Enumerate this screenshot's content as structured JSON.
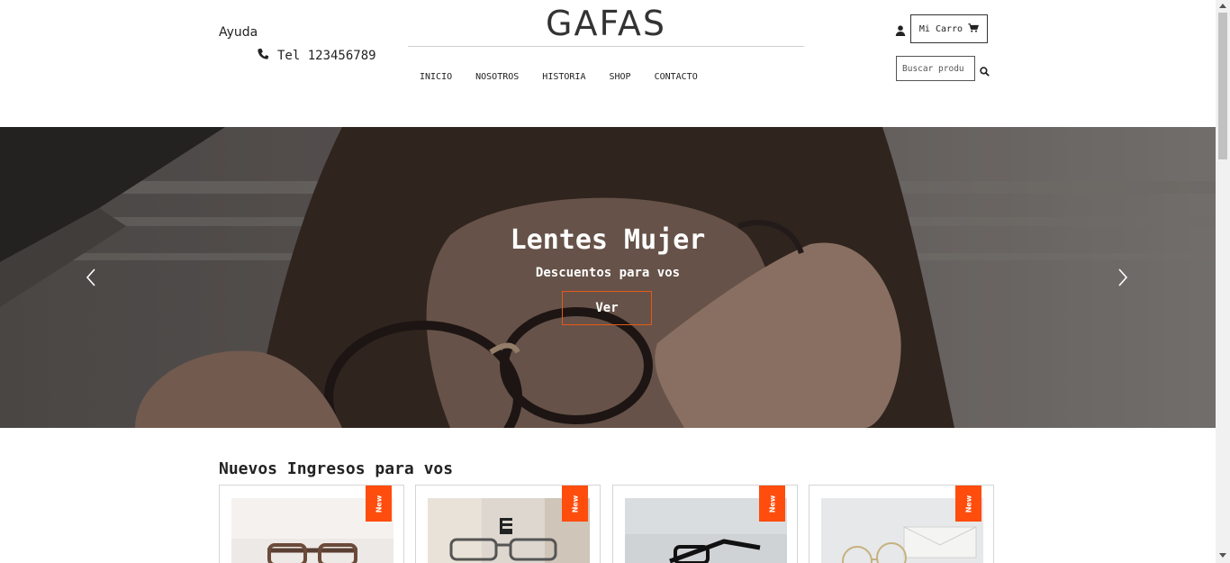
{
  "header": {
    "help_label": "Ayuda",
    "phone_label": "Tel 123456789",
    "logo": "GAFAS",
    "cart_label": "Mi Carro",
    "search_placeholder": "Buscar produ"
  },
  "nav": {
    "items": [
      {
        "label": "INICIO"
      },
      {
        "label": "NOSOTROS"
      },
      {
        "label": "HISTORIA"
      },
      {
        "label": "SHOP"
      },
      {
        "label": "CONTACTO"
      }
    ]
  },
  "hero": {
    "title": "Lentes Mujer",
    "subtitle": "Descuentos para vos",
    "button_label": "Ver"
  },
  "section": {
    "title": "Nuevos Ingresos para vos"
  },
  "products": [
    {
      "badge": "New"
    },
    {
      "badge": "New"
    },
    {
      "badge": "New"
    },
    {
      "badge": "New"
    }
  ],
  "colors": {
    "accent": "#ff4d0d",
    "button_border": "#e45b16",
    "text": "#222222"
  },
  "icons": {
    "phone": "phone-icon",
    "user": "user-icon",
    "cart": "cart-icon",
    "search": "search-icon",
    "prev": "chevron-left-icon",
    "next": "chevron-right-icon"
  }
}
